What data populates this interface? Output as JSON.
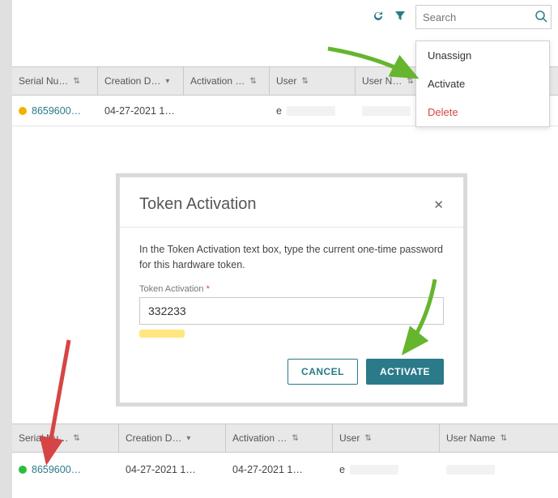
{
  "search": {
    "placeholder": "Search"
  },
  "menu": {
    "unassign": "Unassign",
    "activate": "Activate",
    "delete": "Delete"
  },
  "table1": {
    "headers": {
      "serial": "Serial Nu…",
      "creation": "Creation D…",
      "activation": "Activation …",
      "user": "User",
      "username": "User N…"
    },
    "row": {
      "status_color": "#f2b200",
      "serial": "8659600…",
      "creation": "04-27-2021 1…",
      "activation": "",
      "user": "e",
      "username": "",
      "more": "⋮"
    }
  },
  "modal": {
    "title": "Token Activation",
    "instruction": "In the Token Activation text box, type the current one-time password for this hardware token.",
    "label": "Token Activation",
    "required": "*",
    "value": "332233",
    "cancel": "CANCEL",
    "activate": "ACTIVATE"
  },
  "table2": {
    "headers": {
      "serial": "Serial Nu…",
      "creation": "Creation D…",
      "activation": "Activation …",
      "user": "User",
      "username": "User Name"
    },
    "row": {
      "status_color": "#2dbd3a",
      "serial": "8659600…",
      "creation": "04-27-2021 1…",
      "activation": "04-27-2021 1…",
      "user": "e",
      "username": ""
    }
  },
  "annotations": {
    "arrow_green_menu": "#66b52e",
    "arrow_green_activate": "#66b52e",
    "arrow_red_status": "#d64545"
  }
}
